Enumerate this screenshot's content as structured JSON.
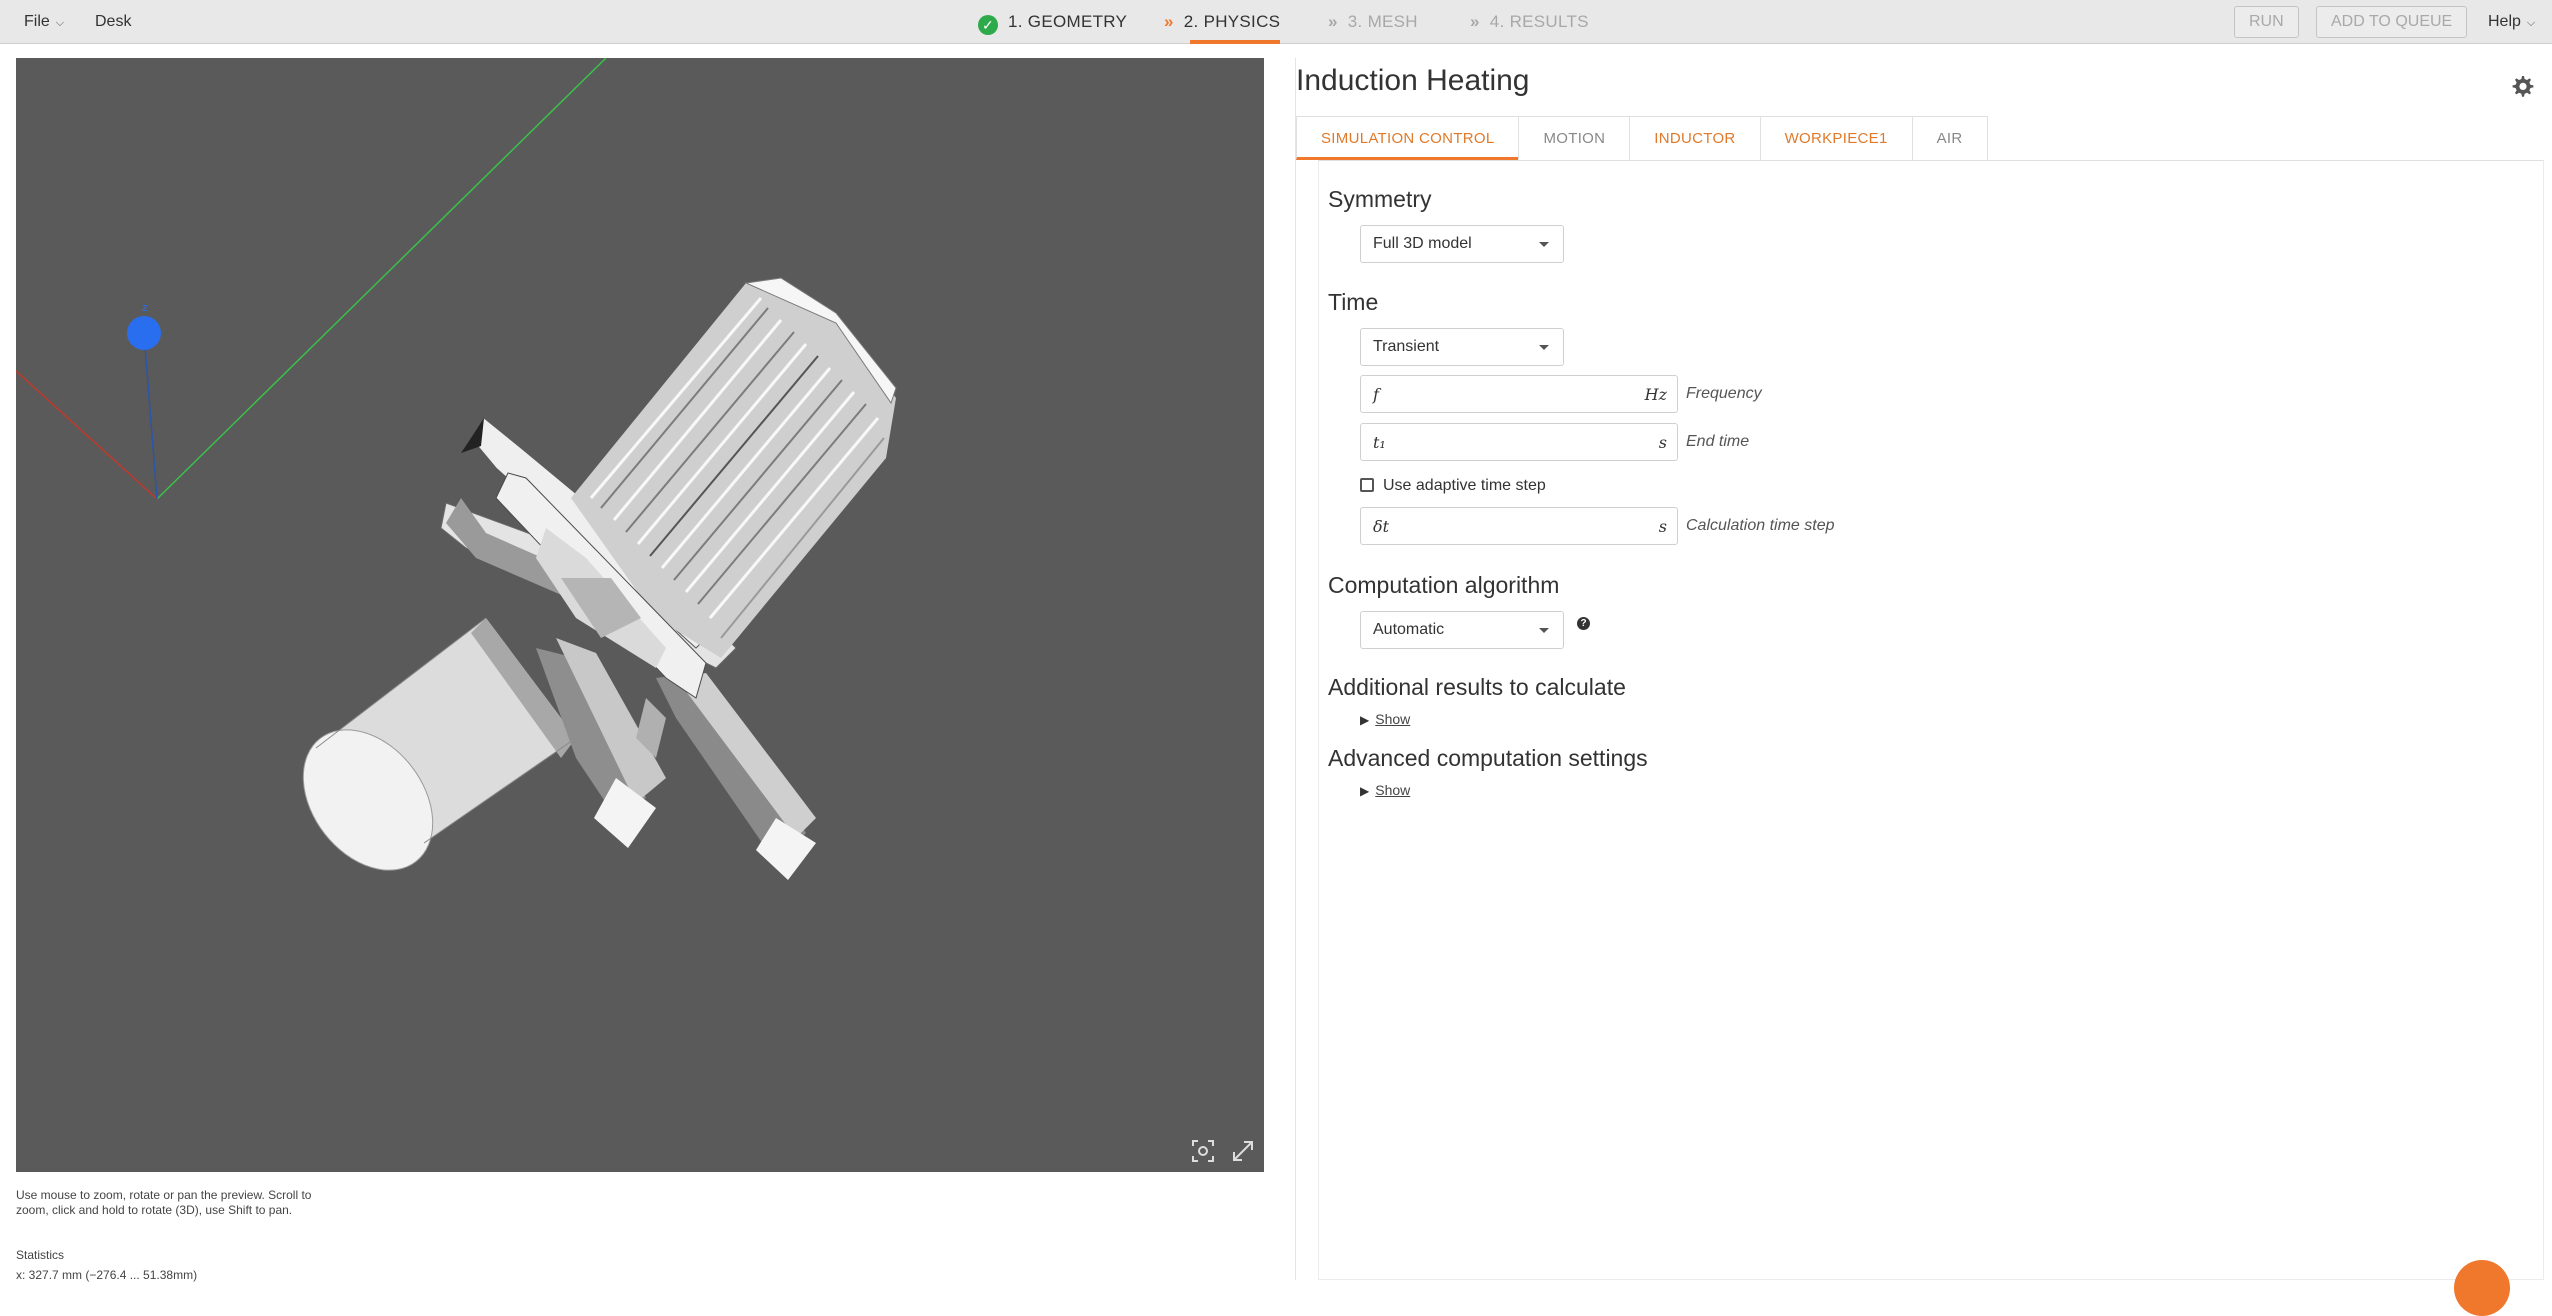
{
  "topbar": {
    "file_label": "File",
    "desk_label": "Desk",
    "steps": [
      {
        "label": "1. GEOMETRY",
        "state": "done"
      },
      {
        "label": "2. PHYSICS",
        "state": "active"
      },
      {
        "label": "3. MESH",
        "state": "disabled"
      },
      {
        "label": "4. RESULTS",
        "state": "disabled"
      }
    ],
    "run_label": "RUN",
    "queue_label": "ADD TO QUEUE",
    "help_label": "Help"
  },
  "viewer": {
    "axis_z_label": "z",
    "hint_text": "Use mouse to zoom, rotate or pan the preview. Scroll to zoom, click and hold to rotate (3D), use Shift to pan.",
    "stats_label": "Statistics",
    "stats_value": "x: 327.7 mm (−276.4 ... 51.38mm)"
  },
  "panel": {
    "title": "Induction Heating",
    "tabs": [
      {
        "label": "SIMULATION CONTROL",
        "state": "active"
      },
      {
        "label": "MOTION",
        "state": "gray"
      },
      {
        "label": "INDUCTOR",
        "state": "orange"
      },
      {
        "label": "WORKPIECE1",
        "state": "orange"
      },
      {
        "label": "AIR",
        "state": "gray"
      }
    ],
    "symmetry": {
      "title": "Symmetry",
      "value": "Full 3D model"
    },
    "time": {
      "title": "Time",
      "mode": "Transient",
      "frequency": {
        "symbol": "f",
        "unit": "Hz",
        "label": "Frequency",
        "value": ""
      },
      "end_time": {
        "symbol": "t₁",
        "unit": "s",
        "label": "End time",
        "value": ""
      },
      "adaptive_label": "Use adaptive time step",
      "adaptive_checked": false,
      "time_step": {
        "symbol": "δt",
        "unit": "s",
        "label": "Calculation time step",
        "value": ""
      }
    },
    "algorithm": {
      "title": "Computation algorithm",
      "value": "Automatic",
      "help": "?"
    },
    "additional": {
      "title": "Additional results to calculate",
      "show_label": "Show"
    },
    "advanced": {
      "title": "Advanced computation settings",
      "show_label": "Show"
    }
  },
  "colors": {
    "accent": "#f0782d",
    "done": "#2eaa4a",
    "viewport_bg": "#5a5a5a",
    "axis_x": "#c0392b",
    "axis_y": "#39c24a",
    "axis_z": "#2a6ef0"
  }
}
